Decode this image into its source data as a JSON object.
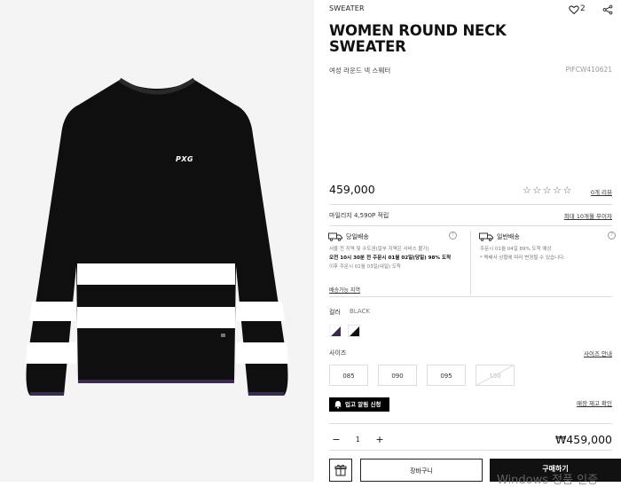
{
  "product": {
    "category": "SWEATER",
    "title": "WOMEN ROUND NECK SWEATER",
    "subtitle_kr": "여성 라운드 넥 스웨터",
    "code": "PIFCW410621",
    "price": "459,000",
    "likes": "2",
    "reviews_label": "0개 리뷰",
    "logo_text": "PXG"
  },
  "mileage": {
    "text": "마일리지 4,590P 적립",
    "link": "최대 10개월 무이자"
  },
  "shipping": {
    "same_day": {
      "title": "당일배송",
      "line1": "서울 전 지역 및 수도권(일부 지역은 서비스 불가)",
      "strong": "오전 10시 30분 전 주문시 01월 02일(당일) 98% 도착",
      "line3": "이후 주문시 01월 03일(내일) 도착"
    },
    "regular": {
      "title": "일반배송",
      "line1": "주문시 01월 04일 89% 도착 예상",
      "line2": "* 택배사 상황에 따라 변경될 수 있습니다."
    },
    "area_link": "배송가능 지역",
    "help": "?"
  },
  "color": {
    "label": "컬러",
    "selected": "BLACK",
    "swatches": [
      "#3d2a4a",
      "#111111"
    ]
  },
  "size": {
    "label": "사이즈",
    "guide": "사이즈 안내",
    "options": [
      "085",
      "090",
      "095",
      "100"
    ]
  },
  "restock": {
    "button": "입고 알림 신청",
    "link": "매장 재고 확인"
  },
  "order": {
    "minus": "−",
    "qty": "1",
    "plus": "+",
    "total": "₩459,000",
    "cart": "장바구니",
    "buy": "구매하기"
  },
  "watermark": "Windows 정품 인증"
}
